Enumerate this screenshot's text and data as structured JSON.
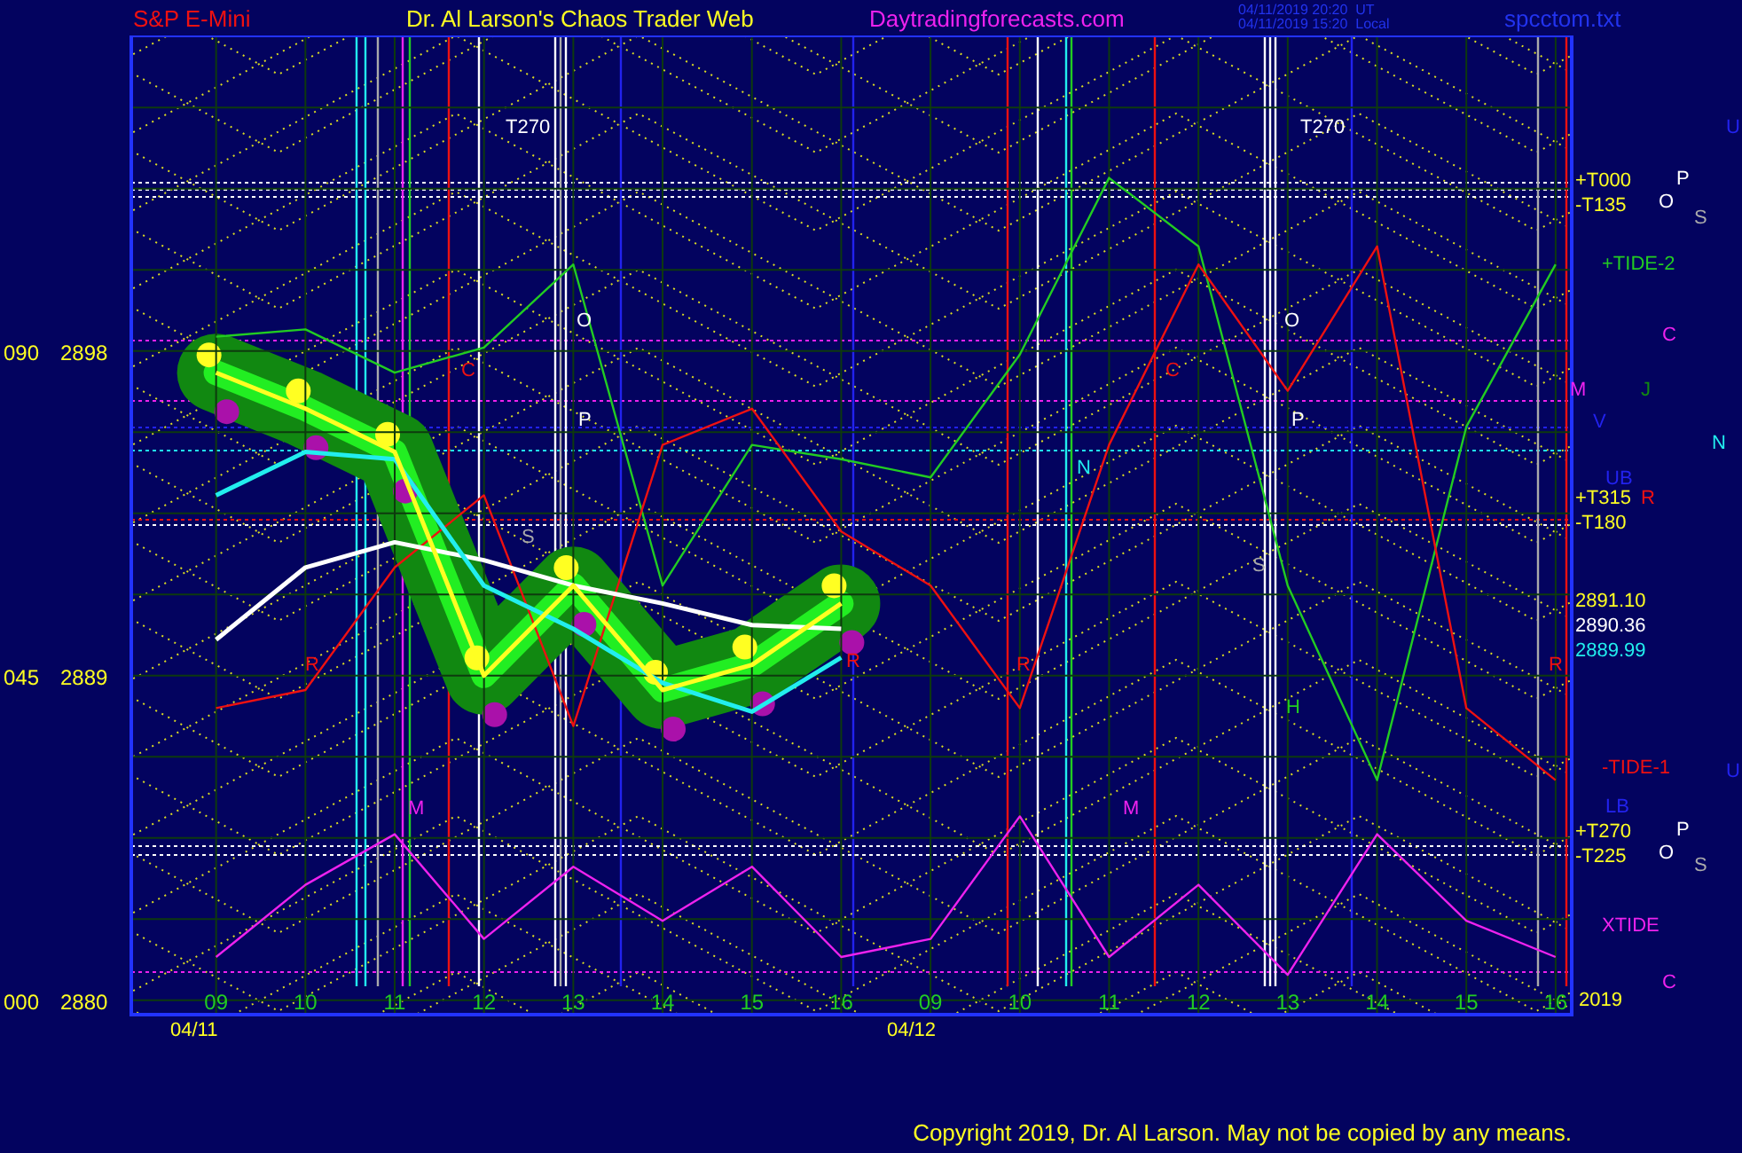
{
  "header": {
    "symbol": "S&P E-Mini",
    "title": "Dr. Al Larson's Chaos Trader Web",
    "site": "Daytradingforecasts.com",
    "timestamps": [
      "04/11/2019 20:20  UT",
      "04/11/2019 15:20  Local"
    ],
    "file": "spcctom.txt"
  },
  "chart": {
    "chart_data": {
      "type": "line",
      "categories": [
        "09",
        "10",
        "11",
        "12",
        "13",
        "14",
        "15",
        "16",
        "09",
        "10",
        "11",
        "12",
        "13",
        "14",
        "15",
        "16"
      ],
      "ylim": [
        2879.6,
        2906.75
      ],
      "yticks": [
        2898,
        2889,
        2880
      ],
      "grid": true,
      "series": [
        {
          "name": "+TIDE-2",
          "color": "#22cc22",
          "values": [
            2898.4,
            2898.6,
            2897.4,
            2898.1,
            2900.4,
            2891.5,
            2895.4,
            2895,
            2894.5,
            2897.9,
            2902.8,
            2900.9,
            2891.5,
            2886.1,
            2895.9,
            2900.4
          ]
        },
        {
          "name": "-TIDE-1",
          "color": "#ee1111",
          "values": [
            2888.1,
            2888.6,
            2892,
            2894,
            2887.6,
            2895.4,
            2896.4,
            2893,
            2891.5,
            2888.1,
            2895.4,
            2900.4,
            2896.9,
            2900.9,
            2888.1,
            2886.1
          ]
        },
        {
          "name": "XTIDE",
          "color": "#ee22ee",
          "values": [
            2881.2,
            2883.2,
            2884.6,
            2881.7,
            2883.7,
            2882.2,
            2883.7,
            2881.2,
            2881.7,
            2885.1,
            2881.2,
            2883.2,
            2880.7,
            2884.6,
            2882.2,
            2881.2
          ]
        },
        {
          "color": "#ffffff",
          "values": [
            2890,
            2892,
            2892.7,
            2892.2,
            2891.5,
            2891,
            2890.4,
            2890.3,
            null,
            null,
            null,
            null,
            null,
            null,
            null,
            null
          ]
        },
        {
          "color": "#22eeee",
          "values": [
            2894,
            2895.2,
            2895,
            2891.5,
            2890.3,
            2888.8,
            2888,
            2889.5,
            null,
            null,
            null,
            null,
            null,
            null,
            null,
            null
          ]
        },
        {
          "color": "#ffff22",
          "values": [
            2897.4,
            2896.4,
            2895.2,
            2889,
            2891.5,
            2888.6,
            2889.3,
            2891,
            null,
            null,
            null,
            null,
            null,
            null,
            null,
            null
          ]
        }
      ]
    },
    "left_scale": [
      "090",
      "045",
      "000"
    ],
    "labels": [
      {
        "text": "T270",
        "color": "#ffffff"
      },
      {
        "text": "T270",
        "color": "#ffffff"
      },
      {
        "text": "O",
        "color": "#ffffff"
      },
      {
        "text": "P",
        "color": "#ffffff"
      },
      {
        "text": "S",
        "color": "#aaaaaa"
      },
      {
        "text": "C",
        "color": "#ee1111"
      },
      {
        "text": "R",
        "color": "#ee1111"
      },
      {
        "text": "M",
        "color": "#ee22ee"
      },
      {
        "text": "R",
        "color": "#ee1111"
      },
      {
        "text": "N",
        "color": "#22eeee"
      },
      {
        "text": "R",
        "color": "#ee1111"
      },
      {
        "text": "C",
        "color": "#ee1111"
      },
      {
        "text": "M",
        "color": "#ee22ee"
      },
      {
        "text": "O",
        "color": "#ffffff"
      },
      {
        "text": "P",
        "color": "#ffffff"
      },
      {
        "text": "S",
        "color": "#aaaaaa"
      },
      {
        "text": "H",
        "color": "#22cc22"
      },
      {
        "text": "U",
        "color": "#2222ee"
      },
      {
        "text": "+T000",
        "color": "#ffff22"
      },
      {
        "text": "-T135",
        "color": "#ffff22"
      },
      {
        "text": "O",
        "color": "#ffffff"
      },
      {
        "text": "P",
        "color": "#ffffff"
      },
      {
        "text": "S",
        "color": "#aaaaaa"
      },
      {
        "text": "C",
        "color": "#ee22ee"
      },
      {
        "text": "M",
        "color": "#ee22ee"
      },
      {
        "text": "J",
        "color": "#118811"
      },
      {
        "text": "V",
        "color": "#2222ee"
      },
      {
        "text": "N",
        "color": "#22eeee"
      },
      {
        "text": "UB",
        "color": "#2222ee"
      },
      {
        "text": "+T315",
        "color": "#ffff22"
      },
      {
        "text": "R",
        "color": "#ee1111"
      },
      {
        "text": "-T180",
        "color": "#ffff22"
      },
      {
        "text": "2891.10",
        "color": "#ffff22"
      },
      {
        "text": "2890.36",
        "color": "#ffffff"
      },
      {
        "text": "2889.99",
        "color": "#22eeee"
      },
      {
        "text": "R",
        "color": "#ee1111"
      },
      {
        "text": "U",
        "color": "#2222ee"
      },
      {
        "text": "LB",
        "color": "#2222ee"
      },
      {
        "text": "+T270",
        "color": "#ffff22"
      },
      {
        "text": "-T225",
        "color": "#ffff22"
      },
      {
        "text": "O",
        "color": "#ffffff"
      },
      {
        "text": "P",
        "color": "#ffffff"
      },
      {
        "text": "S",
        "color": "#aaaaaa"
      },
      {
        "text": "2019",
        "color": "#ffff22"
      },
      {
        "text": "C",
        "color": "#ee22ee"
      },
      {
        "text": "04/11",
        "color": "#ffff22"
      },
      {
        "text": "04/12",
        "color": "#ffff22"
      }
    ]
  },
  "footer": {
    "copyright": "Copyright 2019, Dr. Al Larson. May not be copied by any means."
  }
}
